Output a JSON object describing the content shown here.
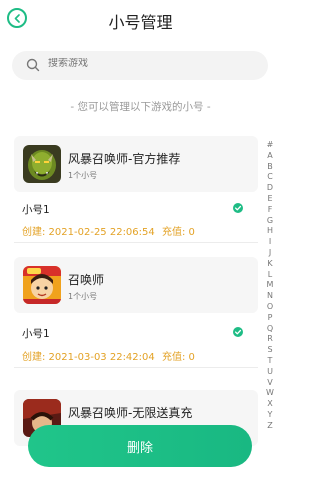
{
  "header": {
    "title": "小号管理"
  },
  "search": {
    "placeholder": "搜索游戏"
  },
  "hint": "- 您可以管理以下游戏的小号 -",
  "games": [
    {
      "name": "风暴召唤师-官方推荐",
      "count": "1个小号",
      "account": "小号1",
      "created": "创建: 2021-02-25 22:06:54",
      "recharge": "充值: 0"
    },
    {
      "name": "召唤师",
      "count": "1个小号",
      "account": "小号1",
      "created": "创建: 2021-03-03 22:42:04",
      "recharge": "充值: 0"
    },
    {
      "name": "风暴召唤师-无限送真充"
    }
  ],
  "alphabet": [
    "#",
    "A",
    "B",
    "C",
    "D",
    "E",
    "F",
    "G",
    "H",
    "I",
    "J",
    "K",
    "L",
    "M",
    "N",
    "O",
    "P",
    "Q",
    "R",
    "S",
    "T",
    "U",
    "V",
    "W",
    "X",
    "Y",
    "Z"
  ],
  "button": {
    "delete_label": "删除"
  },
  "colors": {
    "accent": "#1ebc85",
    "warning": "#e3a226"
  }
}
